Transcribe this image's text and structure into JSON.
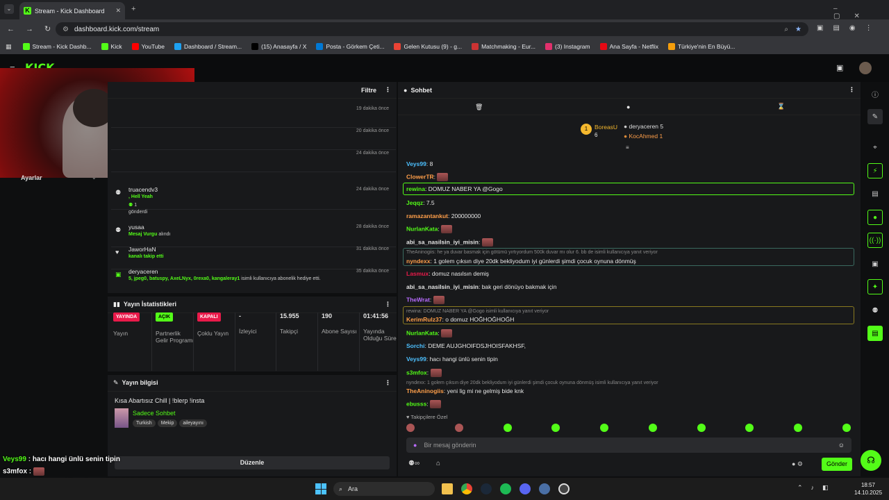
{
  "browser": {
    "tab_title": "Stream - Kick Dashboard",
    "url": "dashboard.kick.com/stream",
    "bookmarks": [
      "Stream - Kick Dashb...",
      "Kick",
      "YouTube",
      "Dashboard / Stream...",
      "(15) Anasayfa / X",
      "Posta - Görkem Çeti...",
      "Gelen Kutusu (9) - g...",
      "Matchmaking - Eur...",
      "(3) Instagram",
      "Ana Sayfa - Netflix",
      "Türkiye'nin En Büyü..."
    ]
  },
  "activity": {
    "filter_label": "Filtre",
    "items": [
      {
        "time": "19 dakika önce"
      },
      {
        "time": "20 dakika önce"
      },
      {
        "time": "24 dakika önce"
      },
      {
        "name": "truacendv3",
        "line1": ", Hell Yeah",
        "line2": "1",
        "line3": "gönderdi",
        "time": "24 dakika önce"
      },
      {
        "name": "yusaa",
        "line1": "Mesaj Vurgu",
        "line1b": "alındı",
        "time": "28 dakika önce"
      },
      {
        "name": "JaworHaN",
        "line1": "kanalı takip etti",
        "time": "31 dakika önce"
      },
      {
        "name": "deryaceren",
        "line1": "5, jpeg0, batuspy, AxeLNyx, 0rexa0, kangaleray1",
        "line1b": "isimli kullanıcıya abonelik hediye etti.",
        "time": "35 dakika önce"
      }
    ],
    "partial_label": "Ayarlar"
  },
  "stats": {
    "title": "Yayın İstatistikleri",
    "cols": [
      {
        "badge": "YAYINDA",
        "badge_color": "#e91a4a",
        "label": "Yayın"
      },
      {
        "badge": "AÇIK",
        "badge_color": "#53fc18",
        "label": "Partnerlik Gelir Programı"
      },
      {
        "badge": "KAPALI",
        "badge_color": "#e91a4a",
        "label": "Çoklu Yayın"
      },
      {
        "value": "-",
        "label": "İzleyici"
      },
      {
        "value": "15.955",
        "label": "Takipçi"
      },
      {
        "value": "190",
        "label": "Abone Sayısı"
      },
      {
        "value": "01:41:56",
        "label": "Yayında Olduğu Süre"
      }
    ]
  },
  "info": {
    "title": "Yayın bilgisi",
    "stream_title": "Kısa Abartısız Chill | !blerp !insta",
    "category": "Sadece Sohbet",
    "tags": [
      "Turkish",
      "Mekip",
      "aileyayını"
    ],
    "edit_label": "Düzenle"
  },
  "chat": {
    "title": "Sohbet",
    "leaders": [
      {
        "name": "BoreasU",
        "count": "6"
      },
      {
        "name": "deryaceren",
        "count": "5"
      },
      {
        "name": "KocAhmed",
        "count": "1"
      }
    ],
    "messages": [
      {
        "user": "Veys99",
        "color": "#4dc0ff",
        "text": "8"
      },
      {
        "user": "ClowerTR",
        "color": "#ff9f4a",
        "text": ""
      },
      {
        "user": "rewina",
        "color": "#53fc18",
        "text": "DOMUZ NABER YA @Gogo"
      },
      {
        "user": "Jeqqz",
        "color": "#53fc18",
        "text": "7.5"
      },
      {
        "user": "ramazantankut",
        "color": "#ff9f4a",
        "text": "200000000"
      },
      {
        "user": "NurlanKata",
        "color": "#53fc18",
        "text": ""
      },
      {
        "user": "abi_sa_nasilsin_iyi_misin",
        "color": "#e6e6e6",
        "text": ""
      },
      {
        "reply": "TheAninogiis: he ya duvar basmak için götümü yırtıyordum 500k duvar mı olur 6. bb de isimli kullanıcıya yanıt veriyor"
      },
      {
        "user": "nyndexx",
        "color": "#ff9f4a",
        "text": "1 golem çıksın diye 20dk bekliyodum iyi günlerdi şimdi çocuk oynuna dönmüş"
      },
      {
        "user": "Lasmux",
        "color": "#e91a4a",
        "text": "domuz nasılsın demiş"
      },
      {
        "user": "abi_sa_nasilsin_iyi_misin",
        "color": "#e6e6e6",
        "text": "bak geri dönüyo bakmak için"
      },
      {
        "user": "TheWrat",
        "color": "#b86bff",
        "text": ""
      },
      {
        "reply": "rewina: DOMUZ NABER YA @Gogo isimli kullanıcıya yanıt veriyor"
      },
      {
        "user": "KerimRulz37",
        "color": "#ff9f4a",
        "text": "o domuz HOĞHOĞHOĞH"
      },
      {
        "user": "NurlanKata",
        "color": "#53fc18",
        "text": ""
      },
      {
        "user": "Sorchi",
        "color": "#4dc0ff",
        "text": "DEME AUJGHOIFDSJHOISFAKHSF,"
      },
      {
        "user": "Veys99",
        "color": "#4dc0ff",
        "text": "hacı hangi ünlü senin tipin"
      },
      {
        "user": "s3mfox",
        "color": "#53fc18",
        "text": ""
      },
      {
        "reply": "nyndexx: 1 golem çıksın diye 20dk bekliyodum iyi günlerdi şimdi çocuk oynuna dönmüş isimli kullanıcıya yanıt veriyor"
      },
      {
        "user": "TheAninogiis",
        "color": "#ff9f4a",
        "text": "yeni lig mi ne gelmiş bide knk"
      },
      {
        "user": "ebusss",
        "color": "#53fc18",
        "text": ""
      }
    ],
    "followers_label": "Takipçilere Özel",
    "input_placeholder": "Bir mesaj gönderin",
    "send_label": "Gönder"
  },
  "overlay": [
    {
      "user": "Veys99",
      "text": "hacı hangi ünlü senin tipin"
    },
    {
      "user": "s3mfox",
      "text": ""
    },
    {
      "user": "TheAninogiis",
      "text": "yeni lig mi ne gelmiş bide knk"
    },
    {
      "user": "ebusss",
      "text": ""
    }
  ],
  "taskbar": {
    "search": "Ara",
    "time": "18:57",
    "date": "14.10.2025"
  }
}
